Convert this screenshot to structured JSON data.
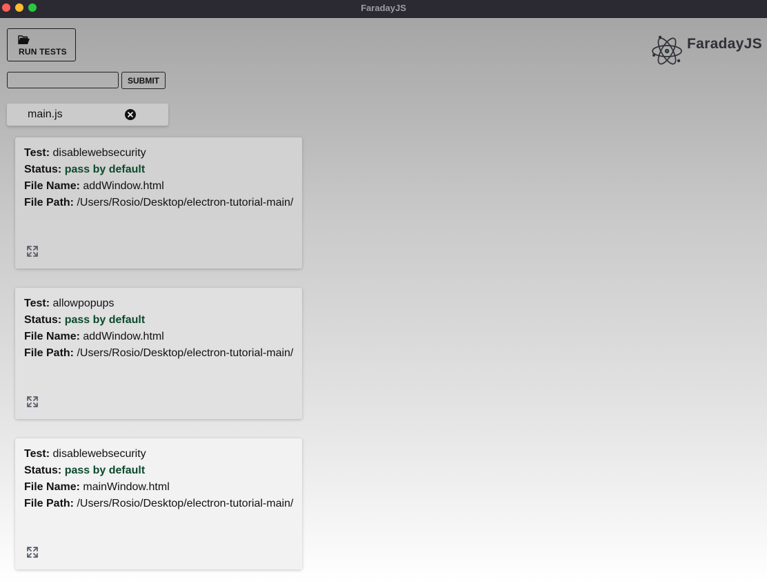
{
  "window": {
    "title": "FaradayJS"
  },
  "toolbar": {
    "run_tests_label": "RUN TESTS",
    "run_tests_icon": "folder-open-icon",
    "input_value": "",
    "input_placeholder": "",
    "submit_label": "SUBMIT"
  },
  "file_chip": {
    "label": "main.js",
    "close_icon": "close-circle-icon"
  },
  "logo": {
    "text": "FaradayJS",
    "icon": "atom-icon"
  },
  "labels": {
    "test": "Test:",
    "status": "Status:",
    "file_name": "File Name:",
    "file_path": "File Path:"
  },
  "colors": {
    "status_pass": "#0b4a2c",
    "titlebar": "#2b2a33",
    "gradient_top": "#a5a5a5",
    "gradient_bottom": "#ffffff"
  },
  "results": [
    {
      "test": "disablewebsecurity",
      "status": "pass by default",
      "file_name": "addWindow.html",
      "file_path": "/Users/Rosio/Desktop/electron-tutorial-main/"
    },
    {
      "test": "allowpopups",
      "status": "pass by default",
      "file_name": "addWindow.html",
      "file_path": "/Users/Rosio/Desktop/electron-tutorial-main/"
    },
    {
      "test": "disablewebsecurity",
      "status": "pass by default",
      "file_name": "mainWindow.html",
      "file_path": "/Users/Rosio/Desktop/electron-tutorial-main/"
    }
  ]
}
